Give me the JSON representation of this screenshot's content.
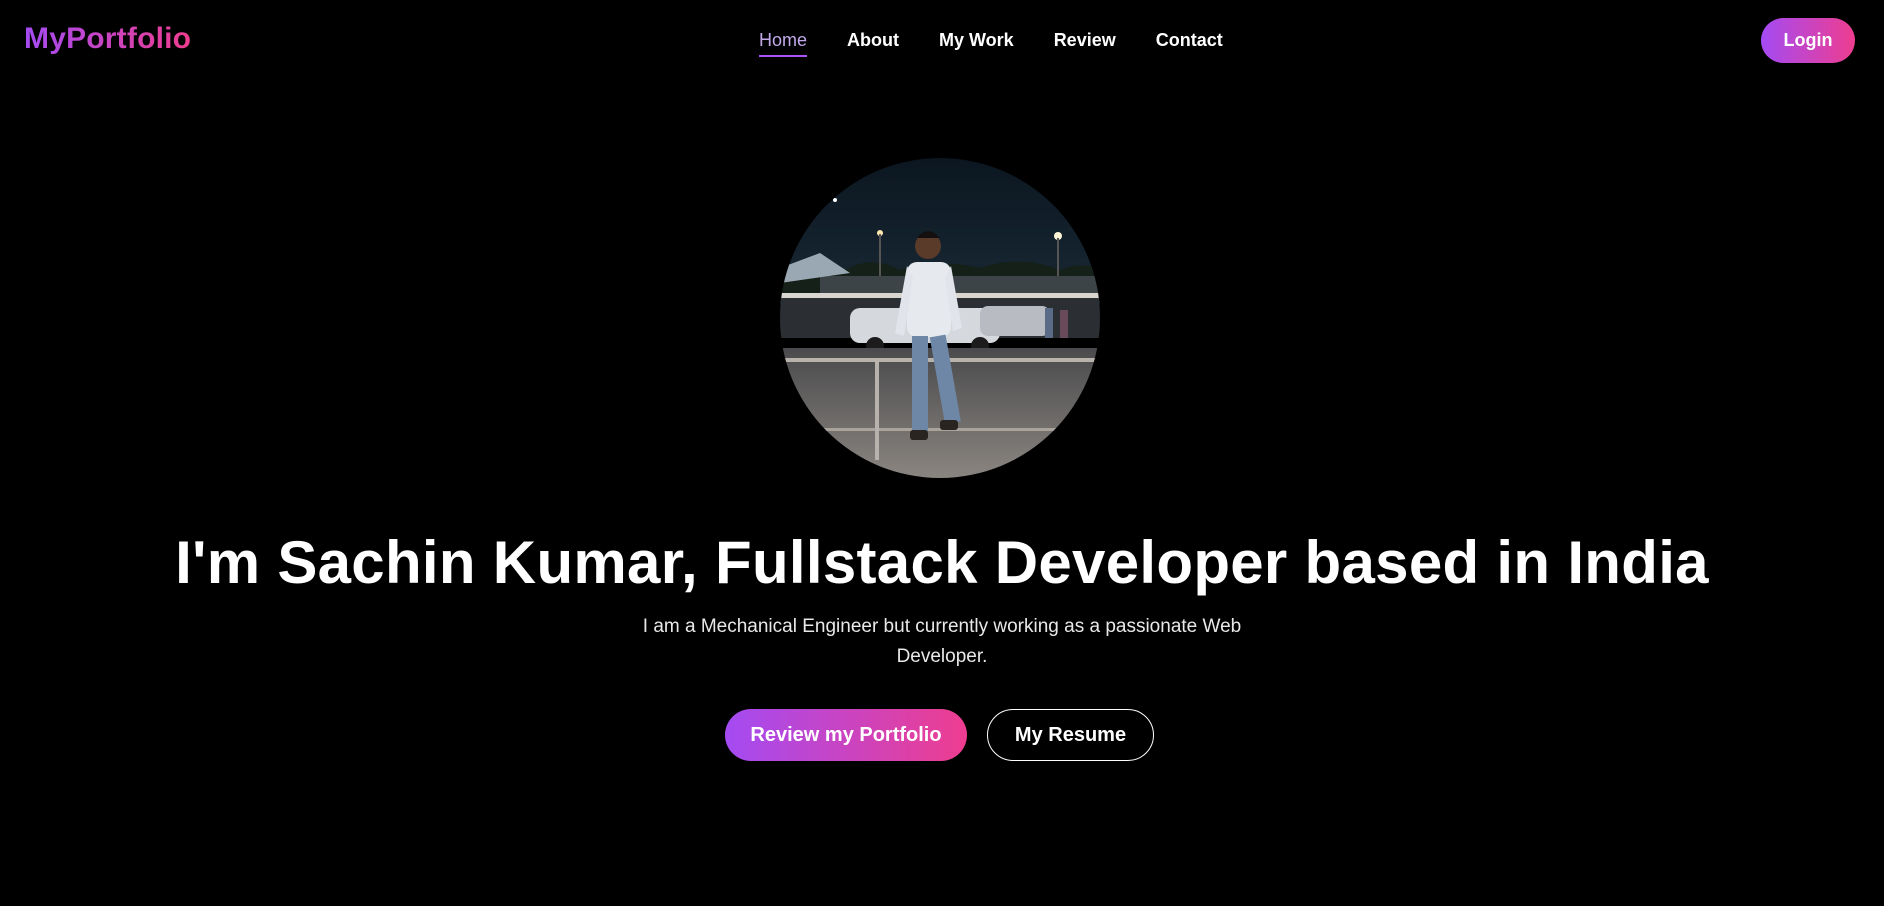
{
  "header": {
    "brand": "MyPortfolio",
    "nav": [
      {
        "label": "Home",
        "active": true
      },
      {
        "label": "About"
      },
      {
        "label": "My Work"
      },
      {
        "label": "Review"
      },
      {
        "label": "Contact"
      }
    ],
    "login_label": "Login"
  },
  "hero": {
    "avatar_icon": "profile-photo",
    "title": "I'm Sachin Kumar, Fullstack Developer based in India",
    "subtitle": "I am a Mechanical Engineer but currently working as a passionate Web Developer.",
    "primary_button": "Review my Portfolio",
    "secondary_button": "My Resume"
  },
  "colors": {
    "background": "#000000",
    "accent_start": "#a44bf3",
    "accent_end": "#ee3d8f",
    "nav_active": "#c2a9ea"
  }
}
